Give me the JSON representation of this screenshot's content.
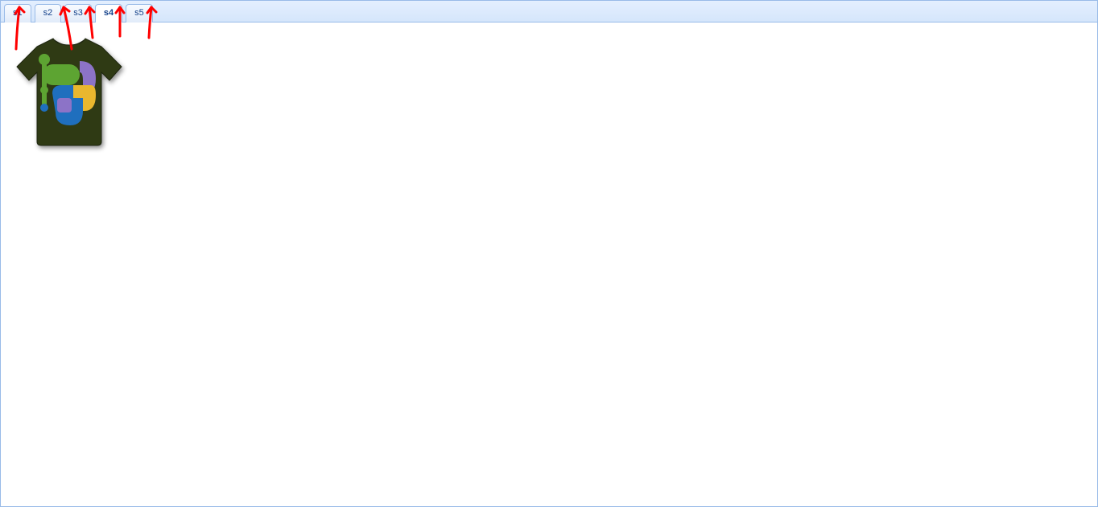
{
  "tabs": [
    {
      "label": "s1",
      "active": false
    },
    {
      "label": "s2",
      "active": false
    },
    {
      "label": "s3",
      "active": false
    },
    {
      "label": "s4",
      "active": true
    },
    {
      "label": "s5",
      "active": false
    }
  ]
}
